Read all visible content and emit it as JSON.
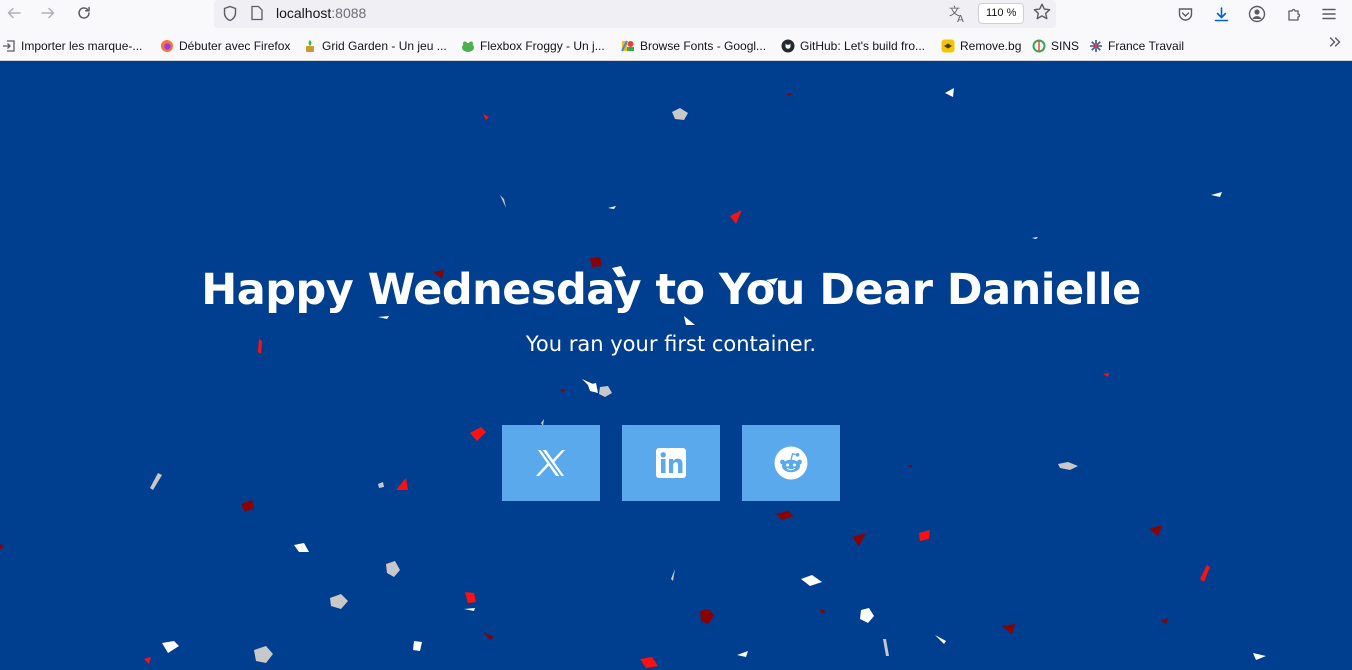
{
  "browser": {
    "url_host": "localhost",
    "url_port": ":8088",
    "zoom": "110 %",
    "icons": {
      "back": "arrow-left-icon",
      "forward": "arrow-right-icon",
      "reload": "reload-icon",
      "tracking": "shield-icon",
      "page": "page-icon",
      "translate": "translate-icon",
      "bookmark_star": "star-icon",
      "pocket": "pocket-icon",
      "downloads": "download-icon",
      "account": "account-icon",
      "extensions": "puzzle-icon",
      "menu": "hamburger-menu-icon",
      "bookmarks_overflow": "chevron-double-right-icon"
    },
    "bookmarks": [
      {
        "label": "Importer les marque-...",
        "icon": "import-icon",
        "color": "#5b5b66"
      },
      {
        "label": "Débuter avec Firefox",
        "icon": "firefox-icon",
        "color": "#ff7139"
      },
      {
        "label": "Grid Garden - Un jeu ...",
        "icon": "grid-garden-icon",
        "color": "#c89b2a"
      },
      {
        "label": "Flexbox Froggy - Un j...",
        "icon": "frog-icon",
        "color": "#4caf50"
      },
      {
        "label": "Browse Fonts - Googl...",
        "icon": "google-fonts-icon",
        "color": "#4285f4"
      },
      {
        "label": "GitHub: Let's build fro...",
        "icon": "github-icon",
        "color": "#24292f"
      },
      {
        "label": "Remove.bg",
        "icon": "removebg-icon",
        "color": "#f5c400"
      },
      {
        "label": "SINS",
        "icon": "sins-icon",
        "color": "#3aa655"
      },
      {
        "label": "France Travail",
        "icon": "france-travail-icon",
        "color": "#3050a0"
      }
    ]
  },
  "page": {
    "background": "#003f8f",
    "headline": "Happy Wednesday to You Dear Danielle",
    "subtitle": "You ran your first container.",
    "share_buttons": [
      {
        "network": "X",
        "icon": "x-logo-icon"
      },
      {
        "network": "LinkedIn",
        "icon": "linkedin-icon"
      },
      {
        "network": "Reddit",
        "icon": "reddit-icon"
      }
    ],
    "button_color": "#5aa9ec",
    "confetti_colors": [
      "#ff1010",
      "#8b0000",
      "#ffffff",
      "#c8c8c8"
    ]
  }
}
